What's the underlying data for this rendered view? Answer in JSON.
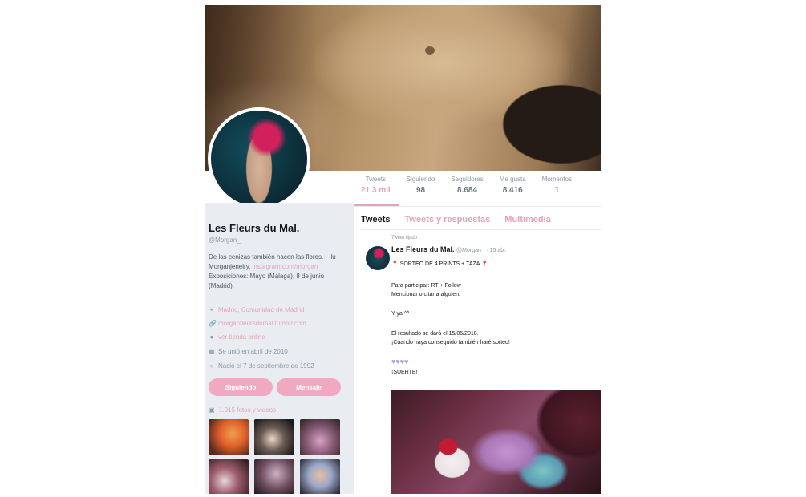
{
  "profile": {
    "name": "Les Fleurs du Mal.",
    "handle": "@Morgan_",
    "bio_text": "De las cenizas también nacen las flores. · Ilu Morganjeneiry.",
    "bio_link": "instagram.com/morgan",
    "bio_rest": " Exposiciones: Mayo (Málaga), 8 de junio (Madrid).",
    "location": "Madrid, Comunidad de Madrid",
    "website": "morganfleursdumal.tumblr.com",
    "shop": "ver tienda online",
    "joined": "Se unió en abril de 2010",
    "birthday": "Nació el 7 de septiembre de 1992",
    "follow_label": "Siguiendo",
    "message_label": "Mensaje",
    "photos_label": "1.015 fotos y videos"
  },
  "stats": [
    {
      "label": "Tweets",
      "value": "21,3 mil"
    },
    {
      "label": "Siguiendo",
      "value": "98"
    },
    {
      "label": "Seguidores",
      "value": "8.684"
    },
    {
      "label": "Me gusta",
      "value": "8.416"
    },
    {
      "label": "Momentos",
      "value": "1"
    }
  ],
  "tabs": [
    "Tweets",
    "Tweets y respuestas",
    "Multimedia"
  ],
  "tweet": {
    "pinned_label": "Tweet fijado",
    "author": "Les Fleurs du Mal.",
    "author_handle": "@Morgan_",
    "time": "· 15 abr.",
    "line1": "SORTEO DE 4 PRINTS + TAZA",
    "line2": "Para participar: RT + Follow",
    "line3": "Mencionar o citar a alguien.",
    "line4": "Y ya ^^",
    "line5": "El resultado se dará el 15/05/2018.",
    "line6": "¡Cuando haya conseguido también haré sorteo!",
    "hearts": "♥♥♥♥",
    "line7": "¡SUERTE!"
  },
  "colors": {
    "accent": "#e8a2b8",
    "sidebar_bg": "#e9edf2",
    "button_bg": "#f0a9c1"
  }
}
